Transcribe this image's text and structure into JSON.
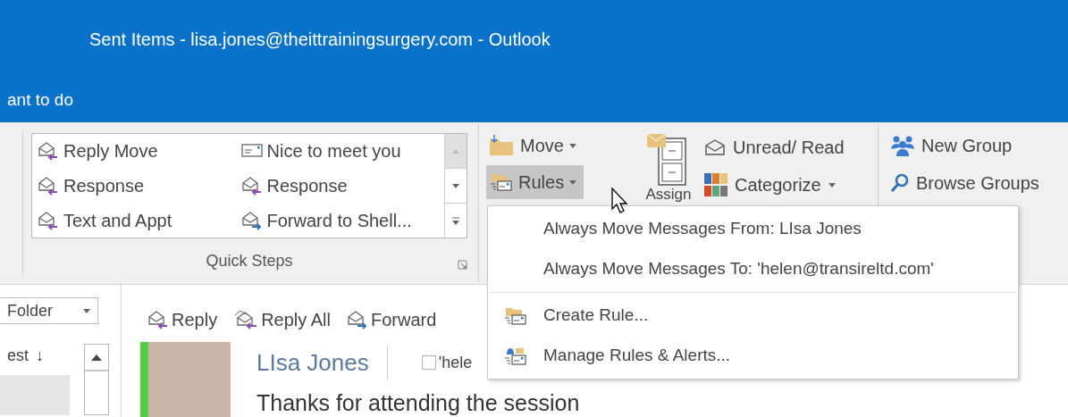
{
  "window": {
    "title": "Sent Items - lisa.jones@theittrainingsurgery.com - Outlook"
  },
  "tell_me": {
    "text": "ant to do"
  },
  "quick_steps": {
    "label": "Quick Steps",
    "items": [
      {
        "label": "Reply Move",
        "kind": "reply"
      },
      {
        "label": "Nice to meet you",
        "kind": "note"
      },
      {
        "label": "Response",
        "kind": "reply"
      },
      {
        "label": "Response",
        "kind": "reply"
      },
      {
        "label": "Text and Appt",
        "kind": "reply"
      },
      {
        "label": "Forward to Shell...",
        "kind": "forward"
      }
    ]
  },
  "move_group": {
    "move": "Move",
    "rules": {
      "label": "Rules",
      "selected": true
    }
  },
  "tags_group": {
    "assign": "Assign",
    "unread": "Unread/ Read",
    "categorize": "Categorize"
  },
  "groups_group": {
    "new_group": "New Group",
    "browse_groups": "Browse Groups"
  },
  "rules_menu": [
    {
      "label": "Always Move Messages From: LIsa Jones",
      "kind": "plain"
    },
    {
      "label": "Always Move Messages To: 'helen@transireltd.com'",
      "kind": "plain"
    },
    {
      "label": "Create Rule...",
      "kind": "create"
    },
    {
      "label": "Manage Rules & Alerts...",
      "kind": "manage"
    }
  ],
  "folder_pane": {
    "folder_dropdown": "Folder",
    "sort": "est",
    "sort_arrow": "↓"
  },
  "message_actions": [
    {
      "label": "Reply",
      "kind": "reply"
    },
    {
      "label": "Reply All",
      "kind": "reply_all"
    },
    {
      "label": "Forward",
      "kind": "forward"
    }
  ],
  "message": {
    "sender": "LIsa Jones",
    "recipient": "'hele",
    "recipient_checked": false,
    "subject": "Thanks for attending the session"
  }
}
